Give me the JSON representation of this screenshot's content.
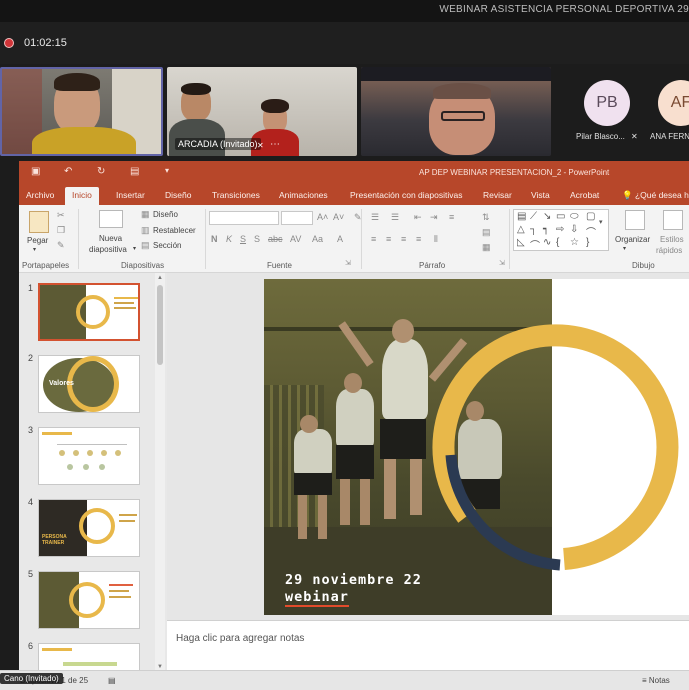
{
  "meeting": {
    "title": "WEBINAR ASISTENCIA PERSONAL DEPORTIVA 29",
    "timer": "01:02:15",
    "colors": {
      "bar": "#1f1f1f",
      "recording": "#d13438",
      "active_border": "#6264a7"
    }
  },
  "participants": {
    "tiles": [
      {
        "label": ""
      },
      {
        "label": "ARCADIA (Invitado)"
      },
      {
        "label": ""
      }
    ],
    "avatars": [
      {
        "initials": "PB",
        "name": "Pilar Blasco..."
      },
      {
        "initials": "AF",
        "name": "ANA FERN..."
      }
    ],
    "presenter_chip": "Cano (Invitado)"
  },
  "powerpoint": {
    "window_title": "AP DEP WEBINAR PRESENTACION_2  -  PowerPoint",
    "accent": "#b7472a",
    "menu": [
      "Archivo",
      "Inicio",
      "Insertar",
      "Diseño",
      "Transiciones",
      "Animaciones",
      "Presentación con diapositivas",
      "Revisar",
      "Vista",
      "Acrobat"
    ],
    "active_tab": "Inicio",
    "tell_me": "¿Qué desea ha",
    "ribbon": {
      "paste": "Pegar",
      "new_slide_1": "Nueva",
      "new_slide_2": "diapositiva",
      "layout": "Diseño",
      "reset": "Restablecer",
      "section": "Sección",
      "arrange": "Organizar",
      "quick_styles_1": "Estilos",
      "quick_styles_2": "rápidos",
      "groups": {
        "clipboard": "Portapapeles",
        "slides": "Diapositivas",
        "font": "Fuente",
        "paragraph": "Párrafo",
        "drawing": "Dibujo"
      }
    },
    "thumbnails": [
      {
        "num": "1",
        "text": ""
      },
      {
        "num": "2",
        "text": "Valores"
      },
      {
        "num": "3",
        "text": ""
      },
      {
        "num": "4",
        "text": "PERSONA TRAINER"
      },
      {
        "num": "5",
        "text": ""
      },
      {
        "num": "6",
        "text": ""
      }
    ],
    "slide": {
      "date": "29 noviembre 22",
      "subtitle": "webinar",
      "ring_color": "#e8b84a",
      "arc_color": "#2b3a52"
    },
    "notes_placeholder": "Haga clic para agregar notas",
    "status": {
      "slide_count": "Diapositiva 1 de 25",
      "notes_button": "Notas"
    }
  }
}
